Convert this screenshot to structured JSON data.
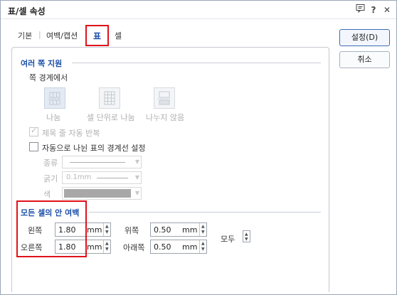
{
  "dialog": {
    "title": "표/셀 속성",
    "title_icons": [
      "comment-icon",
      "help-icon",
      "close-icon"
    ],
    "help_glyph": "?",
    "close_glyph": "✕"
  },
  "tabs": [
    {
      "label": "기본",
      "active": false
    },
    {
      "label": "여백/캡션",
      "active": false
    },
    {
      "label": "표",
      "active": true
    },
    {
      "label": "셀",
      "active": false
    }
  ],
  "buttons": {
    "ok": "설정(D)",
    "cancel": "취소"
  },
  "multi_page": {
    "section_title": "여러 쪽 지원",
    "boundary_label": "쪽 경계에서",
    "options": [
      {
        "label": "나눔",
        "selected": true,
        "disabled": true
      },
      {
        "label": "셀 단위로 나눔",
        "selected": false,
        "disabled": true
      },
      {
        "label": "나누지 않음",
        "selected": false,
        "disabled": true
      }
    ],
    "repeat_title_row": {
      "label": "제목 줄 자동 반복",
      "checked": true,
      "disabled": true
    },
    "auto_border": {
      "label": "자동으로 나뉜 표의 경계선 설정",
      "checked": false,
      "disabled": false
    },
    "border_type_label": "종류",
    "border_width_label": "굵기",
    "border_width_value": "0.1mm",
    "border_color_label": "색"
  },
  "cell_margins": {
    "section_title": "모든 셀의 안 여백",
    "left": {
      "label": "왼쪽",
      "value": "1.80",
      "unit": "mm"
    },
    "right": {
      "label": "오른쪽",
      "value": "1.80",
      "unit": "mm"
    },
    "top": {
      "label": "위쪽",
      "value": "0.50",
      "unit": "mm"
    },
    "bottom": {
      "label": "아래쪽",
      "value": "0.50",
      "unit": "mm"
    },
    "all_label": "모두"
  },
  "colors": {
    "accent": "#1a4ea8",
    "highlight": "#e0121a",
    "disabled_text": "#b0b0b0"
  }
}
